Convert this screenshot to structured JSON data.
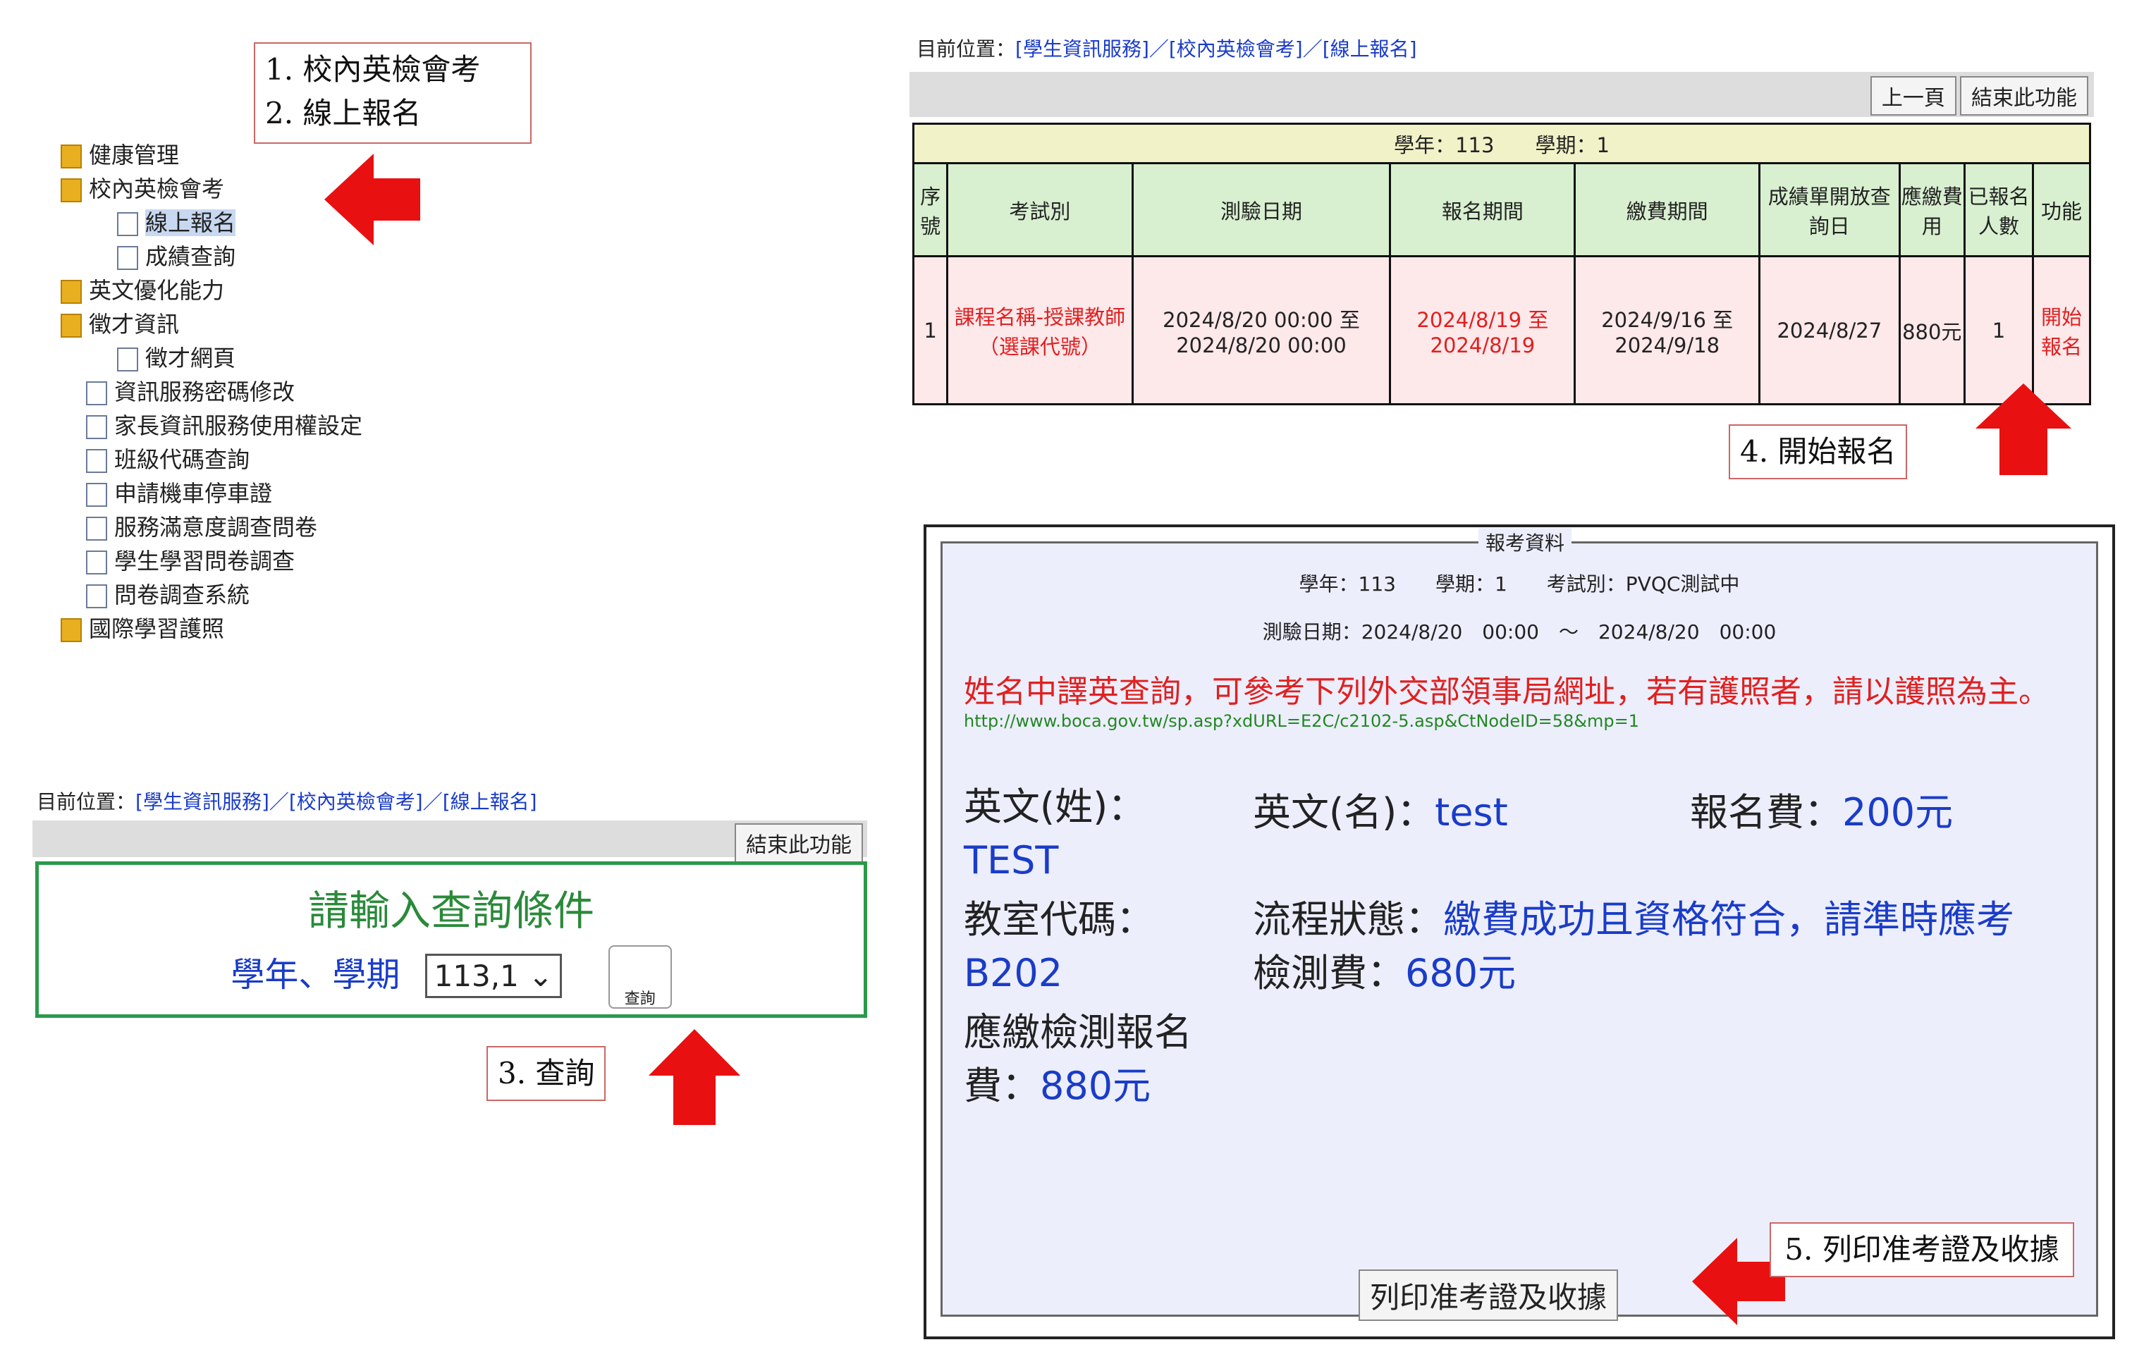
{
  "callouts": {
    "c1a": "1. 校內英檢會考",
    "c1b": "2. 線上報名",
    "c3": "3. 查詢",
    "c4": "4. 開始報名",
    "c5": "5. 列印准考證及收據"
  },
  "tree": [
    "健康管理",
    "校內英檢會考",
    "線上報名",
    "成績查詢",
    "英文優化能力",
    "徵才資訊",
    "徵才網頁",
    "資訊服務密碼修改",
    "家長資訊服務使用權設定",
    "班級代碼查詢",
    "申請機車停車證",
    "服務滿意度調查問卷",
    "學生學習問卷調查",
    "問卷調查系統",
    "國際學習護照"
  ],
  "crumb": {
    "prefix": "目前位置：",
    "path": "[學生資訊服務]／[校內英檢會考]／[線上報名]"
  },
  "query": {
    "end": "結束此功能",
    "title": "請輸入查詢條件",
    "label": "學年、學期",
    "value": "113,1",
    "search": "查詢"
  },
  "table": {
    "prev": "上一頁",
    "end": "結束此功能",
    "year": "學年：113　　學期：1",
    "headers": [
      "序號",
      "考試別",
      "測驗日期",
      "報名期間",
      "繳費期間",
      "成績單開放查詢日",
      "應繳費用",
      "已報名人數",
      "功能"
    ],
    "row": [
      "1",
      "課程名稱-授課教師（選課代號）",
      "2024/8/20 00:00 至 2024/8/20 00:00",
      "2024/8/19 至 2024/8/19",
      "2024/9/16 至 2024/9/18",
      "2024/8/27",
      "880元",
      "1",
      "開始報名"
    ]
  },
  "form": {
    "legend": "報考資料",
    "line1": "學年：113　　學期：1　　考試別：PVQC測試中",
    "line2": "測驗日期：2024/8/20　00:00　～　2024/8/20　00:00",
    "notice": "姓名中譯英查詢，可參考下列外交部領事局網址，若有護照者，請以護照為主。",
    "url": "http://www.boca.gov.tw/sp.asp?xdURL=E2C/c2102-5.asp&CtNodeID=58&mp=1",
    "surname_l": "英文(姓)：",
    "surname": "TEST",
    "given_l": "英文(名)：",
    "given": "test",
    "fee_l": "報名費：",
    "fee": "200元",
    "room_l": "教室代碼：",
    "room": "B202",
    "status_l": "流程狀態：",
    "status": "繳費成功且資格符合，請準時應考",
    "test_l": "檢測費：",
    "test": "680元",
    "due_l": "應繳檢測報名費：",
    "due": "880元",
    "print": "列印准考證及收據"
  }
}
